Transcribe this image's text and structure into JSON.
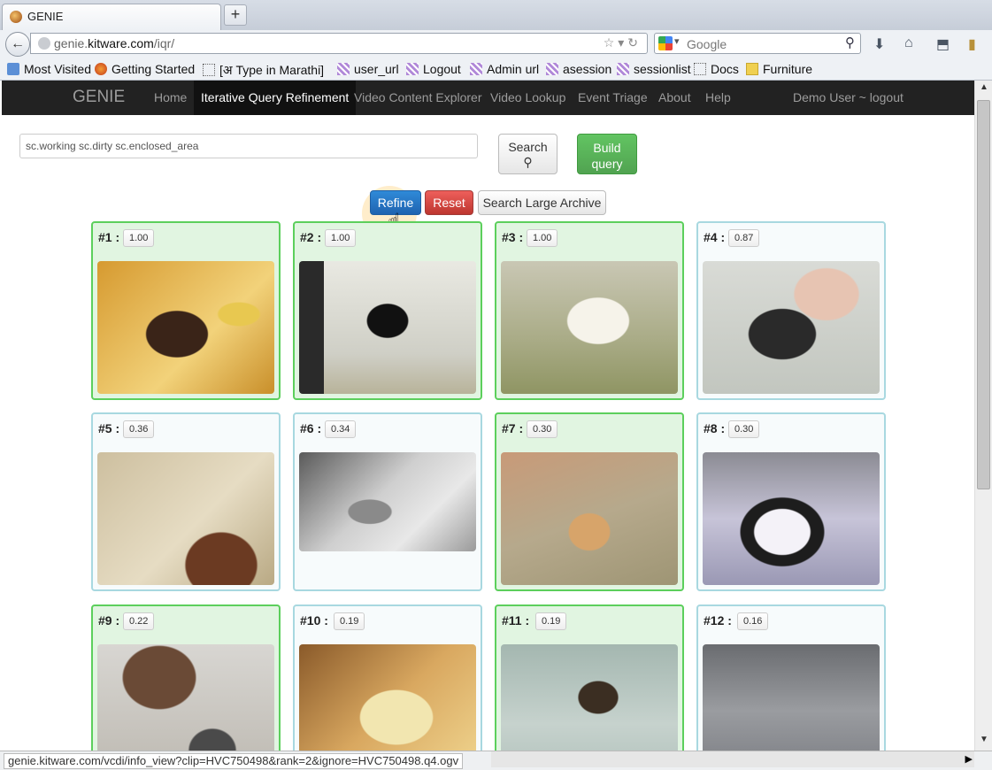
{
  "browser": {
    "tab_title": "GENIE",
    "url_host": "genie.",
    "url_domain": "kitware.com",
    "url_path": "/iqr/",
    "search_placeholder": "Google",
    "status_url": "genie.kitware.com/vcdi/info_view?clip=HVC750498&rank=2&ignore=HVC750498.q4.ogv",
    "bookmarks": [
      "Most Visited",
      "Getting Started",
      "[अ Type in Marathi]",
      "user_url",
      "Logout",
      "Admin url",
      "asession",
      "sessionlist",
      "Docs",
      "Furniture"
    ]
  },
  "app": {
    "brand": "GENIE",
    "nav": [
      "Home",
      "Iterative Query Refinement",
      "Video Content Explorer",
      "Video Lookup",
      "Event Triage",
      "About",
      "Help"
    ],
    "user": "Demo User ~ logout"
  },
  "query": {
    "value": "sc.working sc.dirty sc.enclosed_area",
    "search_label": "Search",
    "build_label_1": "Build",
    "build_label_2": "query",
    "refine_label": "Refine",
    "reset_label": "Reset",
    "archive_label": "Search Large Archive"
  },
  "results": [
    {
      "rank": "#1 :",
      "score": "1.00",
      "selected": true
    },
    {
      "rank": "#2 :",
      "score": "1.00",
      "selected": true
    },
    {
      "rank": "#3 :",
      "score": "1.00",
      "selected": true
    },
    {
      "rank": "#4 :",
      "score": "0.87",
      "selected": false
    },
    {
      "rank": "#5 :",
      "score": "0.36",
      "selected": false
    },
    {
      "rank": "#6 :",
      "score": "0.34",
      "selected": false
    },
    {
      "rank": "#7 :",
      "score": "0.30",
      "selected": true
    },
    {
      "rank": "#8 :",
      "score": "0.30",
      "selected": false
    },
    {
      "rank": "#9 :",
      "score": "0.22",
      "selected": true
    },
    {
      "rank": "#10 :",
      "score": "0.19",
      "selected": false
    },
    {
      "rank": "#11 :",
      "score": "0.19",
      "selected": true
    },
    {
      "rank": "#12 :",
      "score": "0.16",
      "selected": false
    }
  ]
}
